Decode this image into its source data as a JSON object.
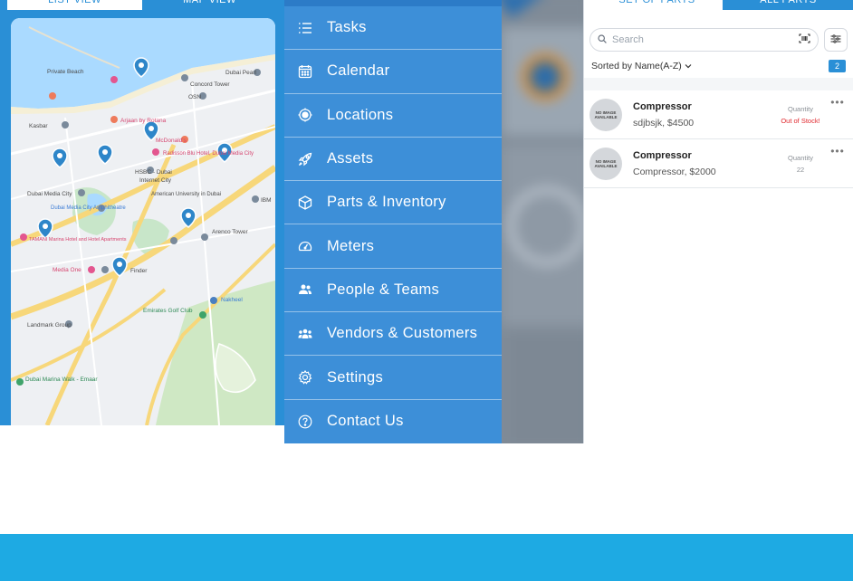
{
  "map_panel": {
    "tabs": [
      {
        "label": "LIST VIEW",
        "active": false
      },
      {
        "label": "MAP VIEW",
        "active": true
      }
    ],
    "labels": [
      "Private Beach",
      "Dubai Pearl",
      "Concord Tower",
      "OSN",
      "Kasbar",
      "Arjaan by Rotana",
      "McDonald's",
      "Radisson Blu Hotel, Dubai Media City",
      "HSBC - Dubai",
      "Internet City",
      "American University in Dubai",
      "Dubai Media City",
      "Dubai Media City Amphitheatre",
      "IBM",
      "Arenco Tower",
      "TAMANI Marina Hotel and Hotel Apartments",
      "Media One",
      "Finder",
      "Emirates Golf Club",
      "Nakheel",
      "Landmark Group",
      "Dubai Marina Walk - Emaar"
    ]
  },
  "menu": {
    "items": [
      {
        "icon": "list-icon",
        "label": "Tasks"
      },
      {
        "icon": "calendar-icon",
        "label": "Calendar"
      },
      {
        "icon": "location-icon",
        "label": "Locations"
      },
      {
        "icon": "rocket-icon",
        "label": "Assets"
      },
      {
        "icon": "cube-icon",
        "label": "Parts & Inventory"
      },
      {
        "icon": "gauge-icon",
        "label": "Meters"
      },
      {
        "icon": "people-icon",
        "label": "People & Teams"
      },
      {
        "icon": "group-icon",
        "label": "Vendors & Customers"
      },
      {
        "icon": "gear-icon",
        "label": "Settings"
      },
      {
        "icon": "help-icon",
        "label": "Contact Us"
      }
    ]
  },
  "parts": {
    "tabs": [
      {
        "label": "SET OF PARTS",
        "active": false
      },
      {
        "label": "ALL PARTS",
        "active": true
      }
    ],
    "search_placeholder": "Search",
    "sort_label": "Sorted by Name(A-Z)",
    "count": "2",
    "no_image_text": "NO IMAGE AVAILABLE",
    "qty_label": "Quantity",
    "rows": [
      {
        "name": "Compressor",
        "subtitle": "sdjbsjk, $4500",
        "quantity": "Out of Stock!",
        "out_of_stock": true
      },
      {
        "name": "Compressor",
        "subtitle": "Compressor, $2000",
        "quantity": "22",
        "out_of_stock": false
      }
    ]
  },
  "colors": {
    "brand_blue": "#2a8fd6",
    "menu_blue": "#3d8fd8",
    "band_blue": "#1eaae3",
    "out_of_stock_red": "#e0282e"
  }
}
